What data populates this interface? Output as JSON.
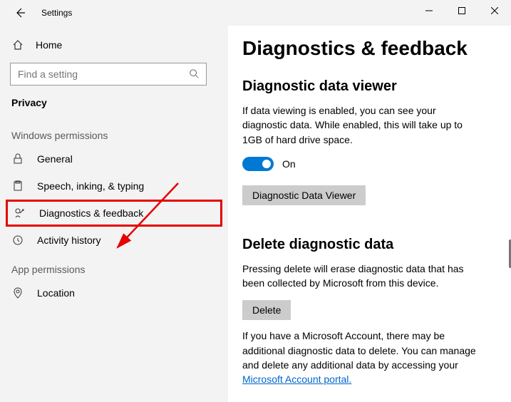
{
  "title": "Settings",
  "sidebar": {
    "home": "Home",
    "search_placeholder": "Find a setting",
    "category": "Privacy",
    "group1_label": "Windows permissions",
    "items1": [
      {
        "label": "General"
      },
      {
        "label": "Speech, inking, & typing"
      },
      {
        "label": "Diagnostics & feedback"
      },
      {
        "label": "Activity history"
      }
    ],
    "group2_label": "App permissions",
    "items2": [
      {
        "label": "Location"
      }
    ]
  },
  "main": {
    "heading": "Diagnostics & feedback",
    "viewer": {
      "title": "Diagnostic data viewer",
      "desc": "If data viewing is enabled, you can see your diagnostic data. While enabled, this will take up to 1GB of hard drive space.",
      "toggle_state": "On",
      "button": "Diagnostic Data Viewer"
    },
    "delete": {
      "title": "Delete diagnostic data",
      "desc": "Pressing delete will erase diagnostic data that has been collected by Microsoft from this device.",
      "button": "Delete",
      "note_pre": "If you have a Microsoft Account, there may be additional diagnostic data to delete. You can manage and delete any additional data by accessing your ",
      "link": "Microsoft Account portal."
    }
  }
}
